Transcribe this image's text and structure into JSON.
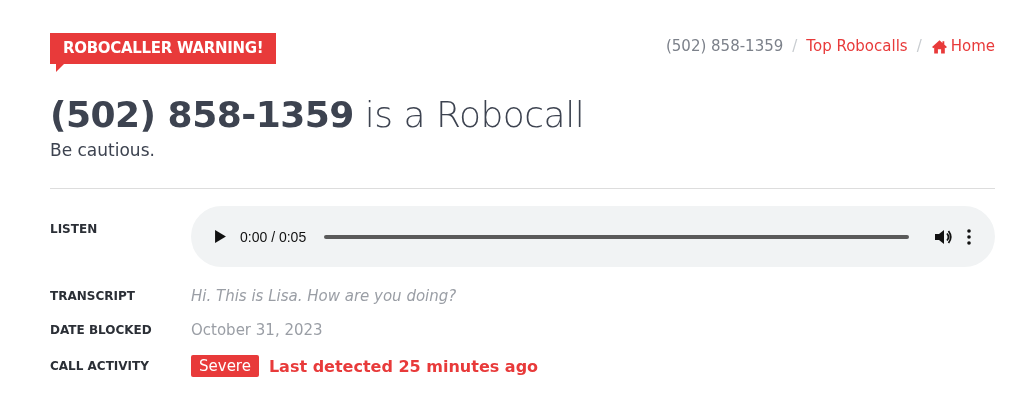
{
  "badge": "ROBOCALLER WARNING!",
  "breadcrumb_separator": "/",
  "breadcrumb": [
    {
      "label": "(502) 858-1359",
      "kind": "current"
    },
    {
      "label": "Top Robocalls",
      "kind": "link"
    },
    {
      "label": "Home",
      "kind": "home"
    }
  ],
  "heading": {
    "number": "(502) 858-1359",
    "rest": "is a Robocall"
  },
  "subtitle": "Be cautious.",
  "details": [
    {
      "label": "LISTEN",
      "kind": "audio",
      "time": "0:00 / 0:05"
    },
    {
      "label": "TRANSCRIPT",
      "kind": "transcript",
      "value": "Hi. This is Lisa. How are you doing?"
    },
    {
      "label": "DATE BLOCKED",
      "kind": "date",
      "value": "October 31, 2023"
    },
    {
      "label": "CALL ACTIVITY",
      "kind": "activity",
      "tag": "Severe",
      "value": "Last detected 25 minutes ago"
    }
  ]
}
